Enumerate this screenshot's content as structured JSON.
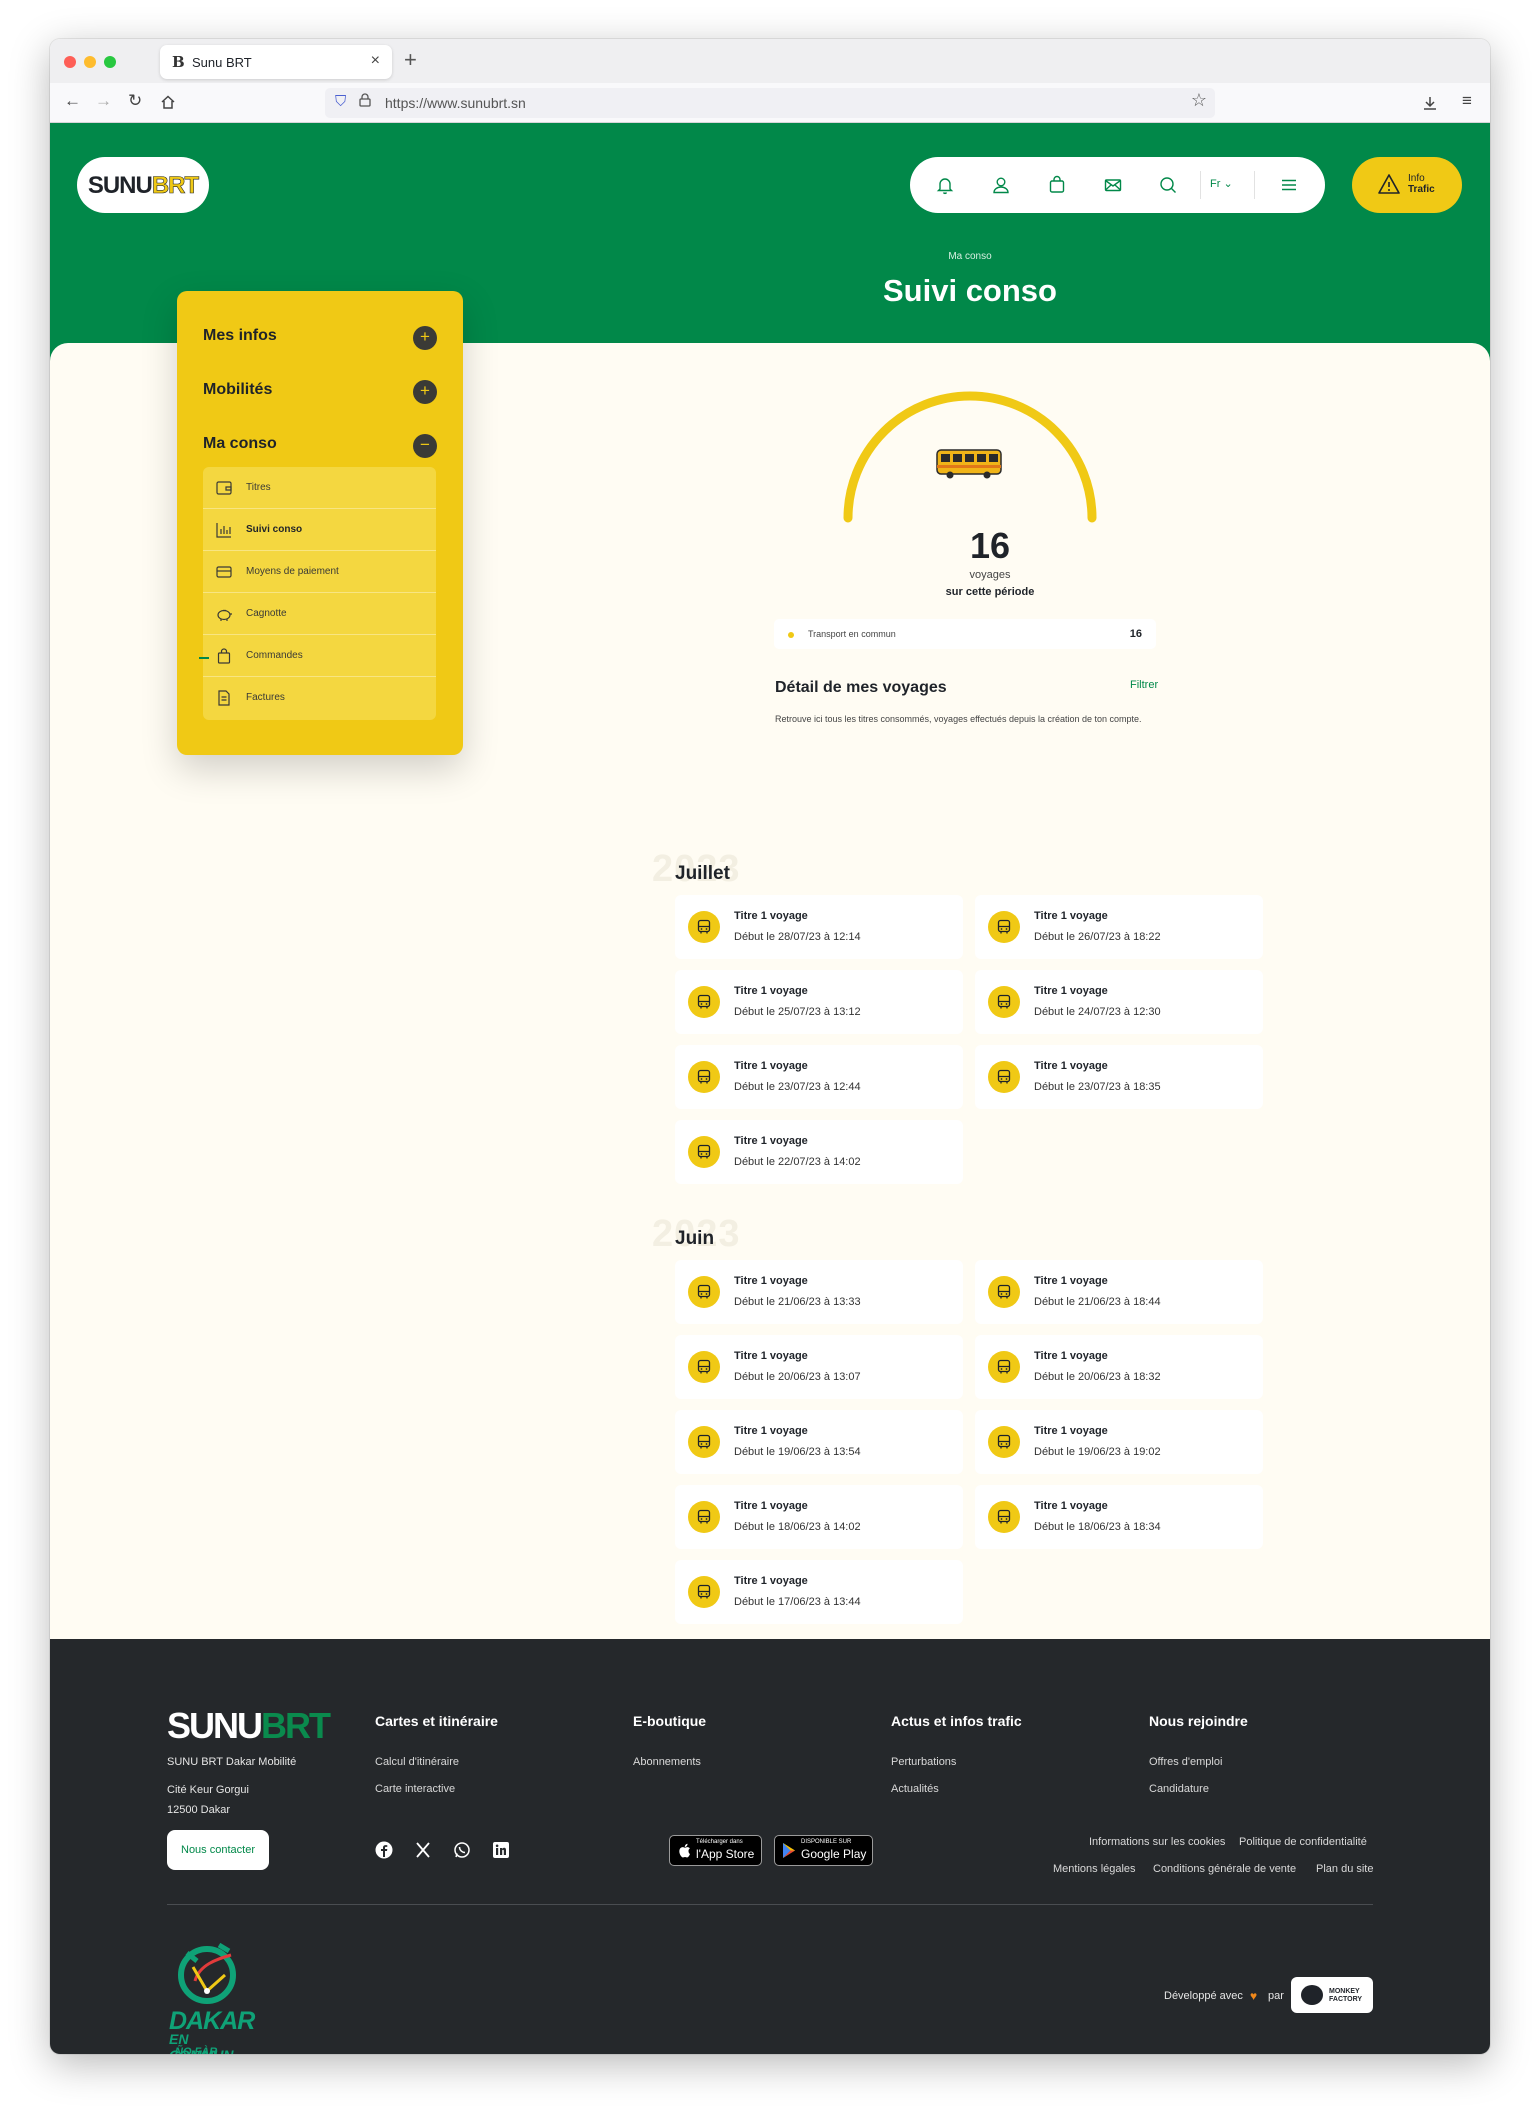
{
  "browser": {
    "tab_title": "Sunu BRT",
    "url": "https://www.sunubrt.sn"
  },
  "header": {
    "logo_part1": "SUNU",
    "logo_part2": "BRT",
    "lang": "Fr",
    "info_line1": "Info",
    "info_line2": "Trafic",
    "breadcrumb": "Ma conso",
    "title": "Suivi conso",
    "nav_icons": [
      "bell-icon",
      "user-icon",
      "bag-icon",
      "mail-icon",
      "search-icon",
      "menu-icon"
    ]
  },
  "sidebar": {
    "sections": [
      "Mes infos",
      "Mobilités",
      "Ma conso"
    ],
    "items": [
      {
        "label": "Titres",
        "icon": "wallet-icon"
      },
      {
        "label": "Suivi conso",
        "icon": "chart-icon",
        "active": true
      },
      {
        "label": "Moyens de paiement",
        "icon": "card-icon"
      },
      {
        "label": "Cagnotte",
        "icon": "piggy-bank-icon"
      },
      {
        "label": "Commandes",
        "icon": "bag-icon"
      },
      {
        "label": "Factures",
        "icon": "invoice-icon"
      }
    ]
  },
  "summary": {
    "count": "16",
    "unit": "voyages",
    "period": "sur cette période",
    "legend_name": "Transport en commun",
    "legend_value": "16",
    "gauge_fill": 1.0
  },
  "detail": {
    "title": "Détail de mes voyages",
    "filter": "Filtrer",
    "subtitle": "Retrouve ici tous les titres consommés, voyages effectués depuis la création de ton compte."
  },
  "months": [
    {
      "year": "2023",
      "name": "Juillet",
      "trips": [
        {
          "title": "Titre 1 voyage",
          "date": "Début le 28/07/23 à 12:14"
        },
        {
          "title": "Titre 1 voyage",
          "date": "Début le 26/07/23 à 18:22"
        },
        {
          "title": "Titre 1 voyage",
          "date": "Début le 25/07/23 à 13:12"
        },
        {
          "title": "Titre 1 voyage",
          "date": "Début le 24/07/23 à 12:30"
        },
        {
          "title": "Titre 1 voyage",
          "date": "Début le 23/07/23 à 12:44"
        },
        {
          "title": "Titre 1 voyage",
          "date": "Début le 23/07/23 à 18:35"
        },
        {
          "title": "Titre 1 voyage",
          "date": "Début le 22/07/23 à 14:02"
        }
      ]
    },
    {
      "year": "2023",
      "name": "Juin",
      "trips": [
        {
          "title": "Titre 1 voyage",
          "date": "Début le 21/06/23 à 13:33"
        },
        {
          "title": "Titre 1 voyage",
          "date": "Début le 21/06/23 à 18:44"
        },
        {
          "title": "Titre 1 voyage",
          "date": "Début le 20/06/23 à 13:07"
        },
        {
          "title": "Titre 1 voyage",
          "date": "Début le 20/06/23 à 18:32"
        },
        {
          "title": "Titre 1 voyage",
          "date": "Début le 19/06/23 à 13:54"
        },
        {
          "title": "Titre 1 voyage",
          "date": "Début le 19/06/23 à 19:02"
        },
        {
          "title": "Titre 1 voyage",
          "date": "Début le 18/06/23 à 14:02"
        },
        {
          "title": "Titre 1 voyage",
          "date": "Début le 18/06/23 à 18:34"
        },
        {
          "title": "Titre 1 voyage",
          "date": "Début le 17/06/23 à 13:44"
        }
      ]
    }
  ],
  "footer": {
    "logo_part1": "SUNU",
    "logo_part2": "BRT",
    "company": "SUNU BRT  Dakar Mobilité",
    "address1": "Cité Keur Gorgui",
    "address2": "12500 Dakar",
    "contact": "Nous contacter",
    "columns": [
      {
        "title": "Cartes et itinéraire",
        "links": [
          "Calcul d'itinéraire",
          "Carte interactive"
        ]
      },
      {
        "title": "E-boutique",
        "links": [
          "Abonnements"
        ]
      },
      {
        "title": "Actus et infos trafic",
        "links": [
          "Perturbations",
          "Actualités"
        ]
      },
      {
        "title": "Nous rejoindre",
        "links": [
          "Offres d'emploi",
          "Candidature"
        ]
      }
    ],
    "social_icons": [
      "facebook-icon",
      "x-icon",
      "whatsapp-icon",
      "linkedin-icon"
    ],
    "appstore_small": "Télécharger dans",
    "appstore_big": "l'App Store",
    "googleplay_small": "DISPONIBLE SUR",
    "googleplay_big": "Google Play",
    "legal1": [
      "Informations sur les cookies",
      "Politique de confidentialité"
    ],
    "legal2": [
      "Mentions légales",
      "Conditions générale de vente",
      "Plan du site"
    ],
    "dakar_line1": "DAKAR",
    "dakar_line2": "EN COMMUN",
    "dakar_line3": "ÑO FÀR",
    "dev_text": "Développé avec",
    "dev_par": "par",
    "agency": "MONKEY FACTORY",
    "agency_line1": "MONKEY",
    "agency_line2": "FACTORY"
  }
}
